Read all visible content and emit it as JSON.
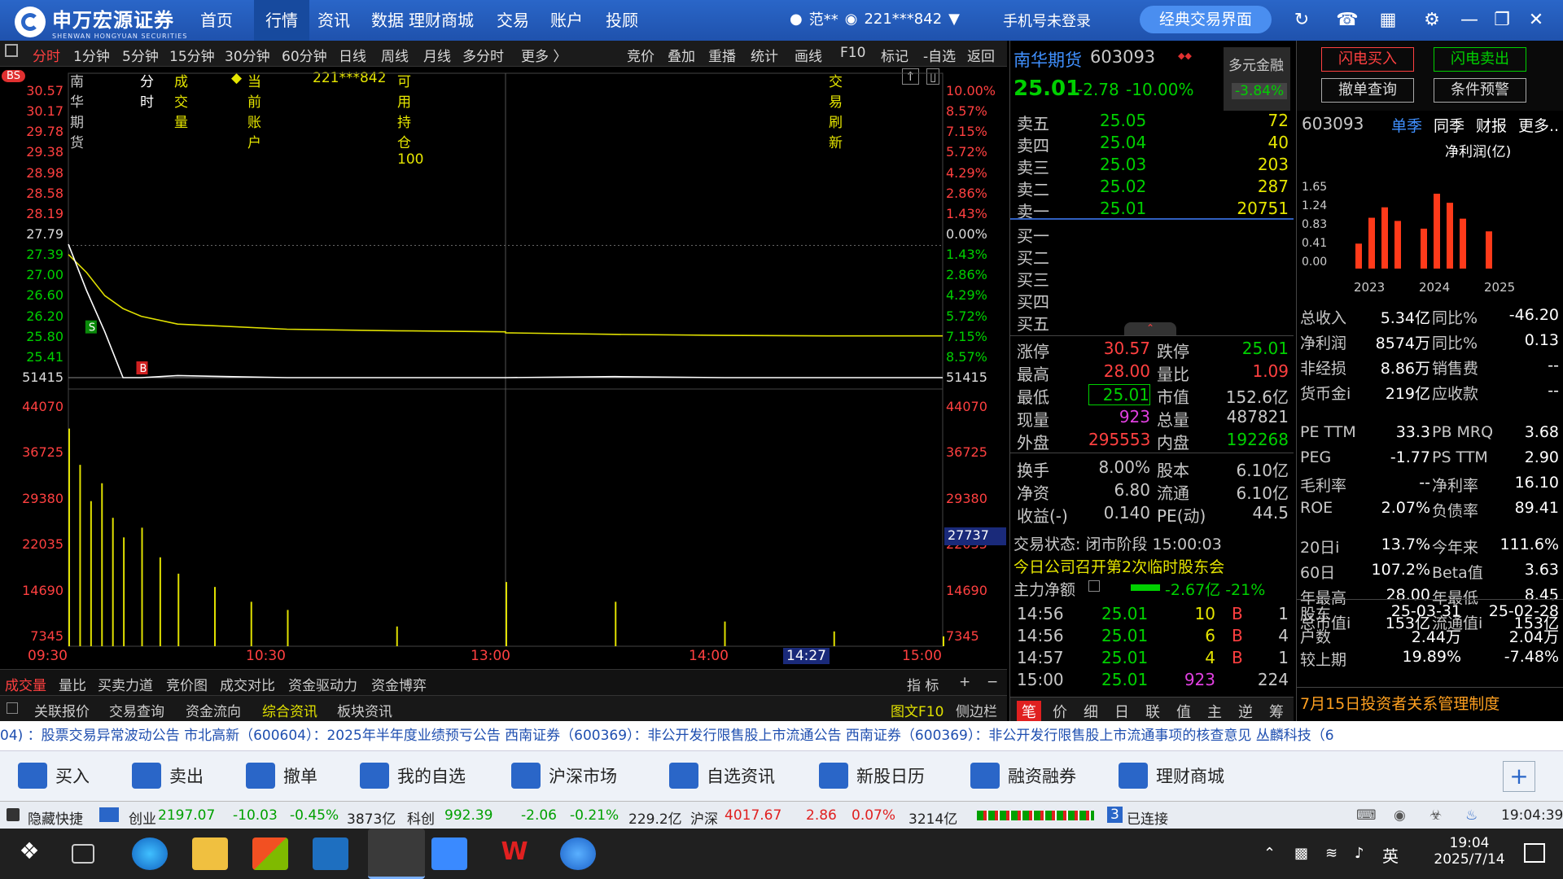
{
  "app": {
    "logo_text": "申万宏源证券",
    "logo_sub": "SHENWAN HONGYUAN SECURITIES"
  },
  "nav": [
    "首页",
    "行情",
    "资讯",
    "数据",
    "理财商城",
    "交易",
    "账户",
    "投顾"
  ],
  "user": {
    "name": "范**",
    "account": "221***842",
    "mobile": "手机号未登录",
    "classic": "经典交易界面"
  },
  "toolbar_left": [
    "分时",
    "1分钟",
    "5分钟",
    "15分钟",
    "30分钟",
    "60分钟",
    "日线",
    "周线",
    "月线",
    "多分时",
    "更多 〉"
  ],
  "toolbar_right": [
    "竞价",
    "叠加",
    "重播",
    "统计",
    "画线",
    "F10",
    "标记",
    "-自选",
    "返回"
  ],
  "chart_header": {
    "badge": "BS",
    "stock": "南华期货",
    "mode": "分时",
    "vol": "成交量",
    "account_label": "当前账户",
    "account": "221***842",
    "holding": "可用持仓 100",
    "refresh": "交易刷新"
  },
  "price_axis_left": [
    "30.57",
    "30.17",
    "29.78",
    "29.38",
    "28.98",
    "28.58",
    "28.19",
    "27.79",
    "27.39",
    "27.00",
    "26.60",
    "26.20",
    "25.80",
    "25.41",
    "51415"
  ],
  "price_axis_right": [
    "10.00%",
    "8.57%",
    "7.15%",
    "5.72%",
    "4.29%",
    "2.86%",
    "1.43%",
    "0.00%",
    "1.43%",
    "2.86%",
    "4.29%",
    "5.72%",
    "7.15%",
    "8.57%",
    "51415"
  ],
  "vol_axis": [
    "44070",
    "36725",
    "29380",
    "22035",
    "14690",
    "7345"
  ],
  "vol_cursor": "27737",
  "time_axis": [
    "09:30",
    "10:30",
    "13:00",
    "14:00",
    "14:27",
    "15:00"
  ],
  "chart_data": {
    "type": "line",
    "title": "南华期货 分时",
    "x": [
      "09:30",
      "09:35",
      "09:40",
      "09:45",
      "09:50",
      "10:00",
      "10:30",
      "11:00",
      "11:30",
      "13:00",
      "13:30",
      "14:00",
      "14:30",
      "15:00"
    ],
    "series": [
      {
        "name": "price",
        "values": [
          27.6,
          26.7,
          25.9,
          25.01,
          25.01,
          25.05,
          25.01,
          25.01,
          25.01,
          25.01,
          25.03,
          25.01,
          25.01,
          25.01
        ]
      },
      {
        "name": "avg",
        "values": [
          27.4,
          27.05,
          26.6,
          26.35,
          26.2,
          26.05,
          25.95,
          25.92,
          25.9,
          25.88,
          25.85,
          25.83,
          25.82,
          25.82
        ]
      }
    ],
    "volume": [
      {
        "t": "09:30",
        "v": 44070
      },
      {
        "t": "09:33",
        "v": 36725
      },
      {
        "t": "09:36",
        "v": 29380
      },
      {
        "t": "09:39",
        "v": 33000
      },
      {
        "t": "09:42",
        "v": 26000
      },
      {
        "t": "09:45",
        "v": 22035
      },
      {
        "t": "09:50",
        "v": 24000
      },
      {
        "t": "09:55",
        "v": 18000
      },
      {
        "t": "10:00",
        "v": 14690
      },
      {
        "t": "10:10",
        "v": 12000
      },
      {
        "t": "10:20",
        "v": 9000
      },
      {
        "t": "10:30",
        "v": 7345
      },
      {
        "t": "11:00",
        "v": 4000
      },
      {
        "t": "13:00",
        "v": 13000
      },
      {
        "t": "13:30",
        "v": 9000
      },
      {
        "t": "14:00",
        "v": 5000
      },
      {
        "t": "14:30",
        "v": 3000
      },
      {
        "t": "15:00",
        "v": 2000
      }
    ],
    "ylim": [
      25.01,
      30.57
    ],
    "vol_ylim": [
      0,
      51415
    ],
    "markers": [
      {
        "label": "S",
        "t": "09:36"
      },
      {
        "label": "B",
        "t": "09:50"
      }
    ]
  },
  "ctabs": [
    "成交量",
    "量比",
    "买卖力道",
    "竞价图",
    "成交对比",
    "资金驱动力",
    "资金博弈"
  ],
  "ctabs_right": [
    "指 标",
    "+",
    "−"
  ],
  "ctabs2": [
    "关联报价",
    "交易查询",
    "资金流向",
    "综合资讯",
    "板块资讯"
  ],
  "ctabs2_right": [
    "图文F10",
    "侧边栏"
  ],
  "quote": {
    "name": "南华期货",
    "code": "603093",
    "price": "25.01",
    "chg": "-2.78",
    "pct": "-10.00%",
    "margin_label": "多元金融",
    "margin_pct": "-3.84%",
    "asks": [
      {
        "l": "卖五",
        "p": "25.05",
        "v": "72"
      },
      {
        "l": "卖四",
        "p": "25.04",
        "v": "40"
      },
      {
        "l": "卖三",
        "p": "25.03",
        "v": "203"
      },
      {
        "l": "卖二",
        "p": "25.02",
        "v": "287"
      },
      {
        "l": "卖一",
        "p": "25.01",
        "v": "20751"
      }
    ],
    "bids": [
      "买一",
      "买二",
      "买三",
      "买四",
      "买五"
    ],
    "stats": [
      [
        "涨停",
        "30.57",
        "跌停",
        "25.01"
      ],
      [
        "最高",
        "28.00",
        "量比",
        "1.09"
      ],
      [
        "最低",
        "25.01",
        "市值",
        "152.6亿"
      ],
      [
        "现量",
        "923",
        "总量",
        "487821"
      ],
      [
        "外盘",
        "295553",
        "内盘",
        "192268"
      ]
    ],
    "stats2": [
      [
        "换手",
        "8.00%",
        "股本",
        "6.10亿"
      ],
      [
        "净资",
        "6.80",
        "流通",
        "6.10亿"
      ],
      [
        "收益(-)",
        "0.140",
        "PE(动)",
        "44.5"
      ]
    ],
    "trade_state": "交易状态: 闭市阶段 15:00:03",
    "notice": "今日公司召开第2次临时股东会",
    "main_flow_label": "主力净额",
    "main_flow": "-2.67亿 -21%",
    "ticks": [
      [
        "14:56",
        "25.01",
        "10",
        "B",
        "1"
      ],
      [
        "14:56",
        "25.01",
        "6",
        "B",
        "4"
      ],
      [
        "14:57",
        "25.01",
        "4",
        "B",
        "1"
      ],
      [
        "15:00",
        "25.01",
        "923",
        "",
        "224"
      ]
    ],
    "tabs": [
      "笔",
      "价",
      "细",
      "日",
      "联",
      "值",
      "主",
      "逆",
      "筹"
    ]
  },
  "buttons": {
    "buy_flash": "闪电买入",
    "sell_flash": "闪电卖出",
    "cancel_query": "撤单查询",
    "alert": "条件预警"
  },
  "fin": {
    "code": "603093",
    "tabs": [
      "单季",
      "同季",
      "财报",
      "更多.."
    ],
    "metric": "净利润(亿)",
    "yaxis": [
      "1.65",
      "1.24",
      "0.83",
      "0.41",
      "0.00"
    ],
    "years": [
      "2023",
      "2024",
      "2025"
    ],
    "bars": [
      0.55,
      1.12,
      1.35,
      1.05,
      0,
      0.88,
      1.65,
      1.45,
      1.1,
      0,
      0.82
    ],
    "rows": [
      [
        "总收入",
        "5.34亿",
        "同比%",
        "-46.20"
      ],
      [
        "净利润",
        "8574万",
        "同比%",
        "0.13"
      ],
      [
        "非经损",
        "8.86万",
        "销售费",
        "--"
      ],
      [
        "货币金i",
        "219亿",
        "应收款",
        "--"
      ]
    ],
    "rows2": [
      [
        "PE TTM",
        "33.3",
        "PB MRQ",
        "3.68"
      ],
      [
        "PEG",
        "-1.77",
        "PS TTM",
        "2.90"
      ],
      [
        "毛利率",
        "--",
        "净利率",
        "16.10"
      ],
      [
        "ROE",
        "2.07%",
        "负债率",
        "89.41"
      ]
    ],
    "rows3": [
      [
        "20日i",
        "13.7%",
        "今年来",
        "111.6%"
      ],
      [
        "60日",
        "107.2%",
        "Beta值",
        "3.63"
      ],
      [
        "年最高",
        "28.00",
        "年最低",
        "8.45"
      ],
      [
        "总市值i",
        "153亿",
        "流通值i",
        "153亿"
      ]
    ],
    "holders": [
      [
        "股东",
        "25-03-31",
        "25-02-28"
      ],
      [
        "户数",
        "2.44万",
        "2.04万"
      ],
      [
        "较上期",
        "19.89%",
        "-7.48%"
      ]
    ],
    "news": "7月15日投资者关系管理制度"
  },
  "ticker": "04) ：股票交易异常波动公告      市北高新（600604）：2025年半年度业绩预亏公告      西南证券（600369）：非公开发行限售股上市流通公告      西南证券（600369）：非公开发行限售股上市流通事项的核查意见      丛麟科技（6",
  "actions": [
    "买入",
    "卖出",
    "撤单",
    "我的自选",
    "沪深市场",
    "自选资讯",
    "新股日历",
    "融资融券",
    "理财商城"
  ],
  "status": {
    "hide": "隐藏快捷",
    "cy": "创业",
    "cy_val": "2197.07",
    "cy_chg": "-10.03",
    "cy_pct": "-0.45%",
    "cy_amt": "3873亿",
    "kc": "科创",
    "kc_val": "992.39",
    "kc_chg": "-2.06",
    "kc_pct": "-0.21%",
    "kc_amt": "229.2亿",
    "hs": "沪深",
    "hs_val": "4017.67",
    "hs_chg": "2.86",
    "hs_pct": "0.07%",
    "hs_amt": "3214亿",
    "conn": "已连接",
    "conn_n": "3",
    "time": "19:04:39"
  },
  "taskbar": {
    "time": "19:04",
    "date": "2025/7/14",
    "ime": "英"
  }
}
